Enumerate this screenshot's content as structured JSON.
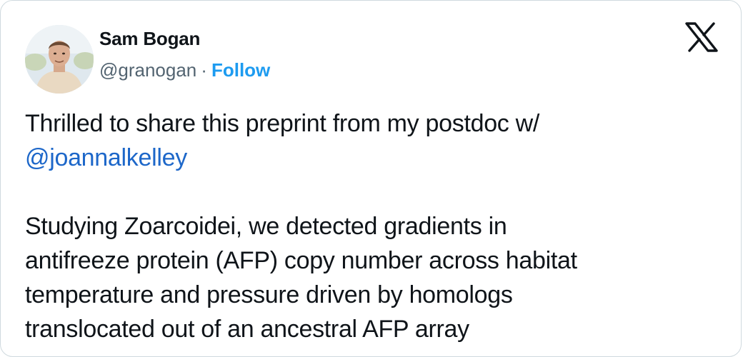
{
  "author": {
    "name": "Sam Bogan",
    "handle": "@granogan",
    "separator": "·",
    "follow_label": "Follow"
  },
  "logo": {
    "icon": "x-logo-icon"
  },
  "tweet": {
    "line1_text": "Thrilled to share this preprint from my postdoc w/",
    "mention": "@joannalkelley",
    "paragraph2": [
      "Studying Zoarcoidei, we detected gradients in",
      "antifreeze protein (AFP) copy number across habitat",
      "temperature and pressure driven by homologs",
      "translocated out of an ancestral AFP array"
    ]
  },
  "colors": {
    "link": "#1d9bf0",
    "mention": "#1d67c9",
    "text": "#0f1419",
    "secondary": "#536471",
    "border": "#cfd9de"
  }
}
